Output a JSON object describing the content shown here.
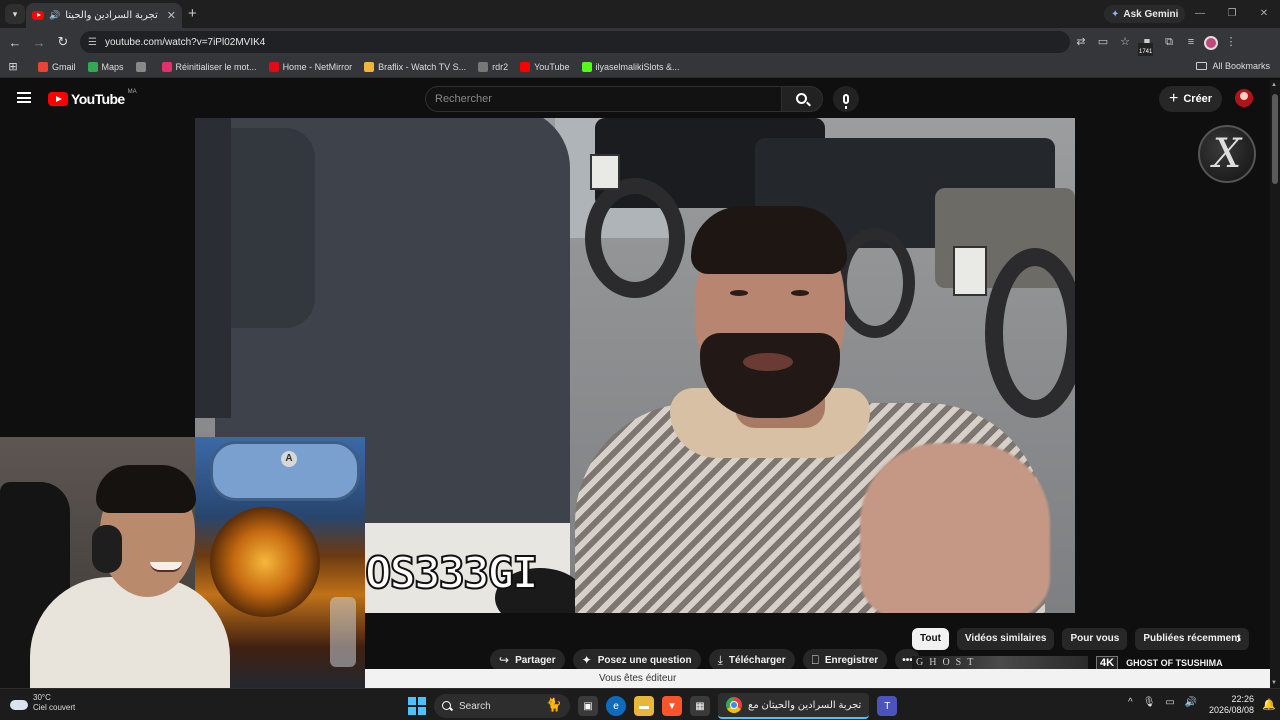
{
  "browser": {
    "tab_title": "تجربة السرادين والحيتان مع",
    "tab_audio_icon": "speaker-icon",
    "ask_gemini": "Ask Gemini",
    "url": "youtube.com/watch?v=7iPl02MVIK4",
    "extension_count": "1741",
    "bookmarks": [
      {
        "label": "Gmail",
        "color": "#ea4335"
      },
      {
        "label": "Maps",
        "color": "#34a853"
      },
      {
        "label": "",
        "color": "#888888"
      },
      {
        "label": "Réinitialiser le mot...",
        "color": "#e1306c"
      },
      {
        "label": "Home - NetMirror",
        "color": "#e50914"
      },
      {
        "label": "Braflix - Watch TV S...",
        "color": "#f3b43b"
      },
      {
        "label": "rdr2",
        "color": "#777777"
      },
      {
        "label": "YouTube",
        "color": "#ff0000"
      },
      {
        "label": "ilyaselmalikiSlots &...",
        "color": "#53fc18"
      }
    ],
    "all_bookmarks": "All Bookmarks"
  },
  "youtube": {
    "logo_text": "YouTube",
    "country_code": "MA",
    "search_placeholder": "Rechercher",
    "create_label": "Créer",
    "video_overlay_text": "OS333GI",
    "chips": [
      "Tout",
      "Vidéos similaires",
      "Pour vous",
      "Publiées récemment"
    ],
    "actions": [
      {
        "icon": "share-icon",
        "label": "Partager"
      },
      {
        "icon": "sparkle-icon",
        "label": "Posez une question"
      },
      {
        "icon": "download-icon",
        "label": "Télécharger"
      },
      {
        "icon": "bookmark-icon",
        "label": "Enregistrer"
      }
    ],
    "related": {
      "thumb_text": "GHOST",
      "badge": "4K",
      "title": "GHOST OF TSUSHIMA"
    },
    "editor_notice": "Vous êtes éditeur"
  },
  "taskbar": {
    "weather_temp": "30°C",
    "weather_desc": "Ciel couvert",
    "search_label": "Search",
    "chrome_title": "تجربة السرادين والحيتان مع",
    "time": "22:26",
    "date": "2026/08/08"
  }
}
